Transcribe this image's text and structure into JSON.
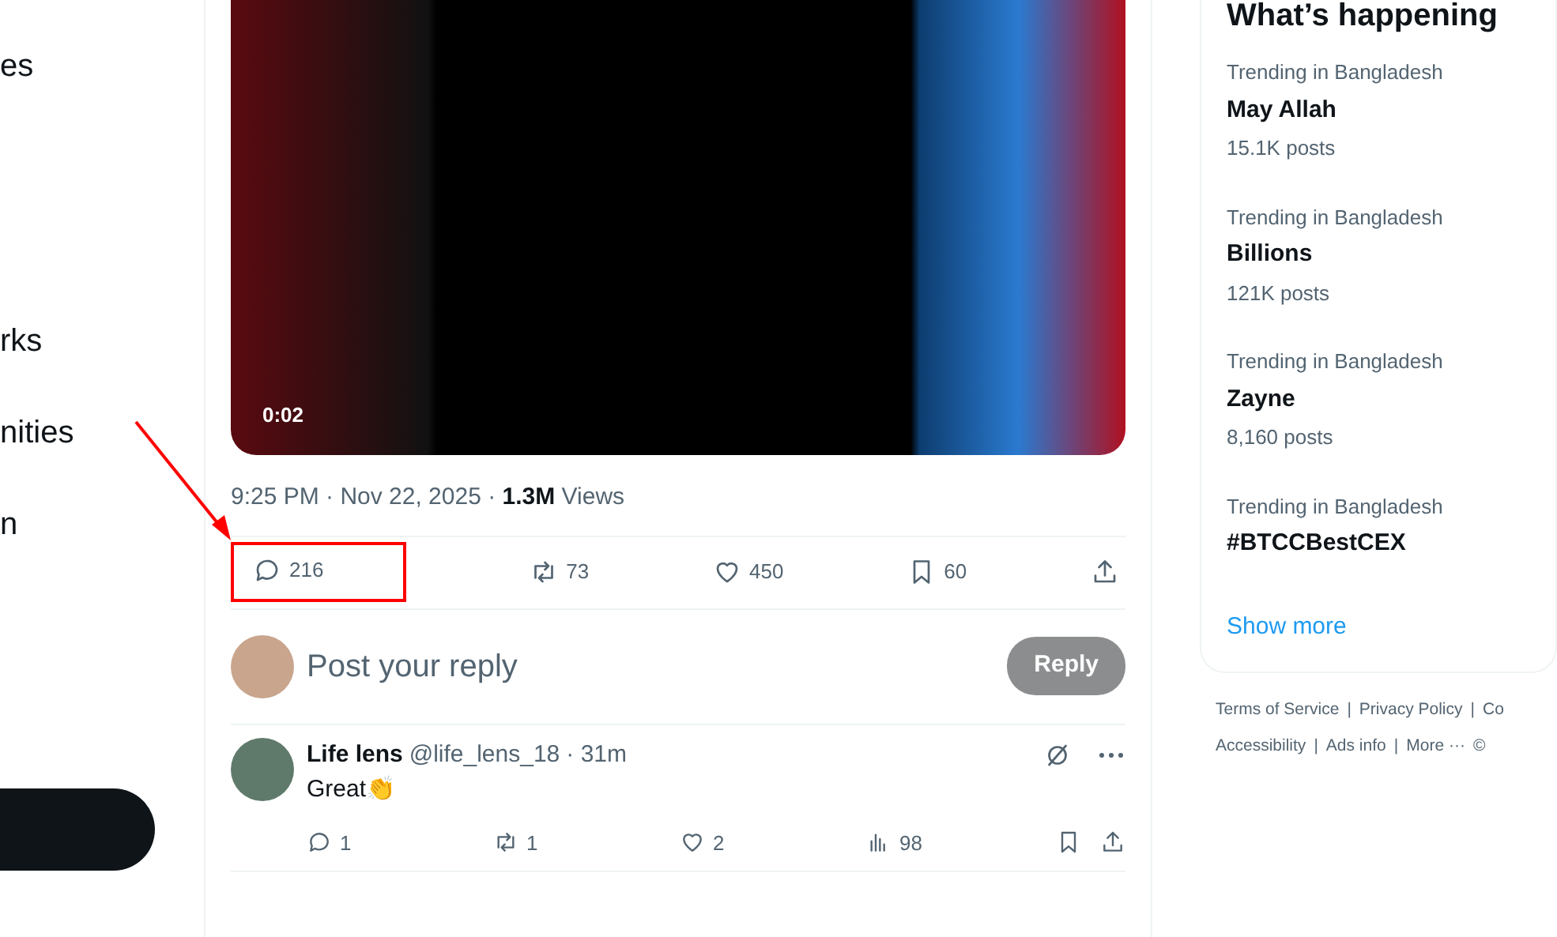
{
  "sidebar": {
    "items": [
      {
        "label": "es"
      },
      {
        "label": "rks"
      },
      {
        "label": "nities"
      },
      {
        "label": "n"
      }
    ]
  },
  "post": {
    "video": {
      "duration": "0:02"
    },
    "meta": "9:25 PM · Nov 22, 2025 · **1.3M** Views",
    "actions": [
      {
        "kind": "reply",
        "count": "216",
        "highlighted": true
      },
      {
        "kind": "repost",
        "count": "73",
        "highlighted": false
      },
      {
        "kind": "like",
        "count": "450",
        "highlighted": false
      },
      {
        "kind": "bookmark",
        "count": "60",
        "highlighted": false
      },
      {
        "kind": "share",
        "highlighted": false
      }
    ]
  },
  "reply_composer": {
    "placeholder": "Post your reply",
    "button": "Reply",
    "disabled": true
  },
  "replies": [
    {
      "name": "Life lens",
      "handle": "@life_lens_18",
      "time": "· 31m",
      "text": "Great👏",
      "actions": [
        {
          "kind": "reply",
          "count": "1"
        },
        {
          "kind": "repost",
          "count": "1"
        },
        {
          "kind": "like",
          "count": "2"
        },
        {
          "kind": "views",
          "count": "98"
        },
        {
          "kind": "bookmark"
        },
        {
          "kind": "share"
        }
      ]
    }
  ],
  "trends": {
    "title": "What’s happening",
    "items": [
      {
        "context": "Trending in Bangladesh",
        "name": "May Allah",
        "posts": "15.1K posts"
      },
      {
        "context": "Trending in Bangladesh",
        "name": "Billions",
        "posts": "121K posts"
      },
      {
        "context": "Trending in Bangladesh",
        "name": "Zayne",
        "posts": "8,160 posts"
      },
      {
        "context": "Trending in Bangladesh",
        "name": "#BTCCBestCEX"
      }
    ],
    "show_more": "Show more"
  },
  "footer": [
    [
      "Terms of Service",
      "|",
      "Privacy Policy",
      "|",
      "Co"
    ],
    [
      "Accessibility",
      "|",
      "Ads info",
      "|",
      "More ···",
      "©"
    ]
  ]
}
